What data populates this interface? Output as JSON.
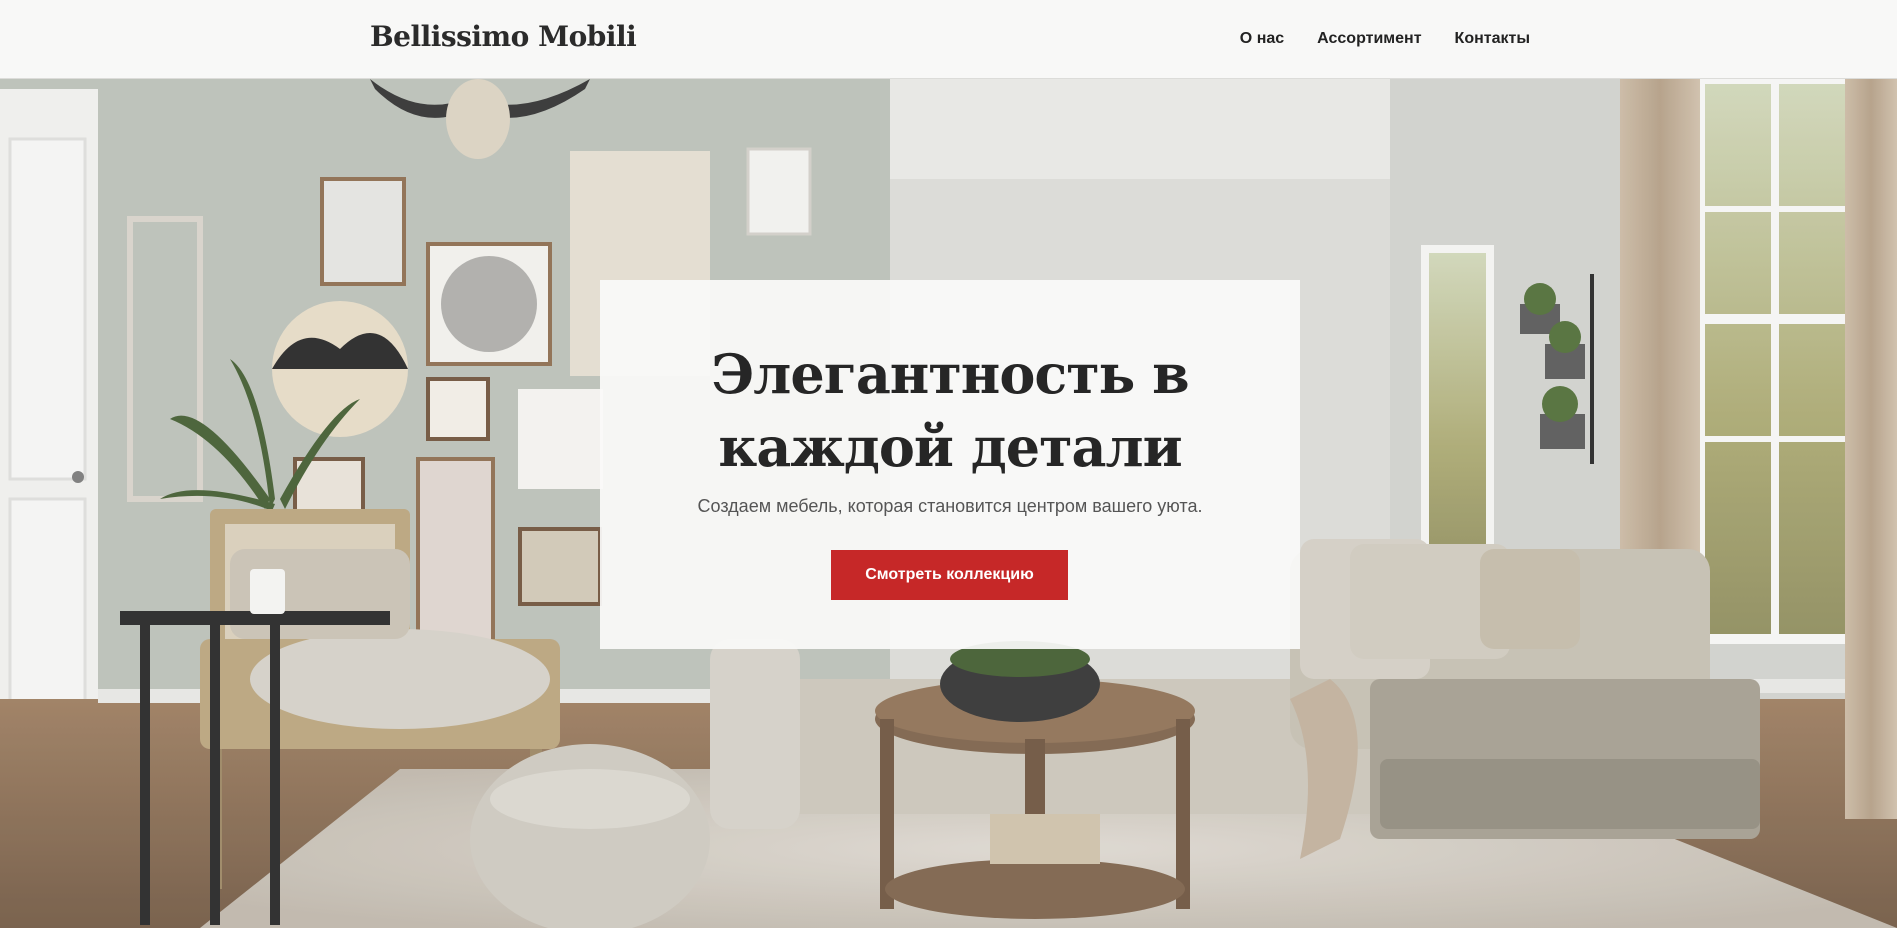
{
  "header": {
    "brand": "Bellissimo Mobili",
    "nav": [
      {
        "label": "О нас"
      },
      {
        "label": "Ассортимент"
      },
      {
        "label": "Контакты"
      }
    ]
  },
  "hero": {
    "title_line1": "Элегантность в",
    "title_line2": "каждой детали",
    "subtitle": "Создаем мебель, которая становится центром вашего уюта.",
    "cta_label": "Смотреть коллекцию",
    "image_description_icon": "living-room-photo"
  },
  "colors": {
    "accent": "#c62828",
    "header_bg": "#f8f8f7",
    "text_dark": "#262626"
  }
}
